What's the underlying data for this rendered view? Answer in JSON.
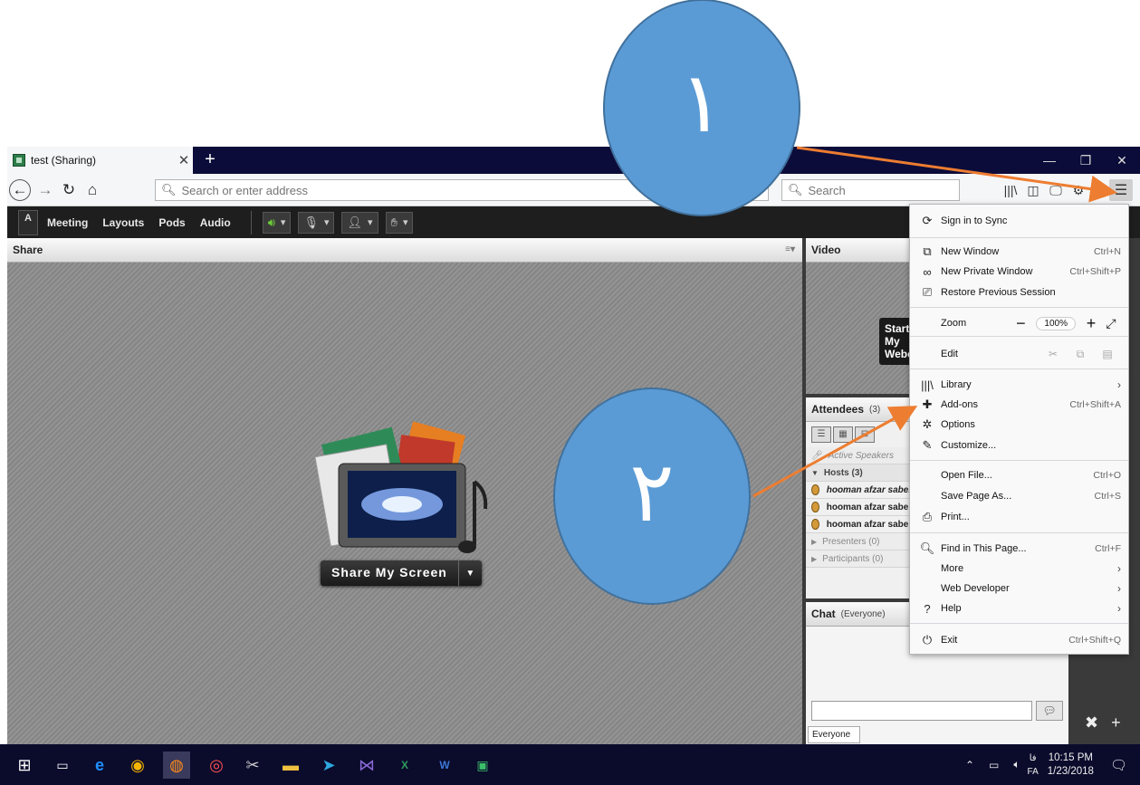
{
  "browser": {
    "tab_title": "test (Sharing)",
    "new_tab": "+",
    "url_placeholder": "Search or enter address",
    "search_placeholder": "Search"
  },
  "app": {
    "logo_text": "Adobe",
    "menu": [
      "Meeting",
      "Layouts",
      "Pods",
      "Audio"
    ],
    "share_pod_title": "Share",
    "share_button_label": "Share My Screen",
    "video_pod_title": "Video",
    "start_camera_label": "Start My Webcam",
    "attendees_title": "Attendees",
    "attendees_count": "(3)",
    "attendee_rows": [
      {
        "kind": "dim",
        "label": "Active Speakers"
      },
      {
        "kind": "sect",
        "label": "Hosts (3)"
      },
      {
        "kind": "user",
        "label": "hooman afzar saberi"
      },
      {
        "kind": "user",
        "label": "hooman afzar saberi"
      },
      {
        "kind": "user",
        "label": "hooman afzar saberi"
      },
      {
        "kind": "dim",
        "label": "Presenters (0)"
      },
      {
        "kind": "dim",
        "label": "Participants (0)"
      }
    ],
    "chat_title": "Chat",
    "chat_scope": "(Everyone)",
    "chat_tab": "Everyone"
  },
  "firefox_menu": {
    "sign_in": "Sign in to Sync",
    "new_window": "New Window",
    "new_window_sc": "Ctrl+N",
    "new_private": "New Private Window",
    "new_private_sc": "Ctrl+Shift+P",
    "restore": "Restore Previous Session",
    "zoom_label": "Zoom",
    "zoom_value": "100%",
    "edit_label": "Edit",
    "library": "Library",
    "addons": "Add-ons",
    "addons_sc": "Ctrl+Shift+A",
    "options": "Options",
    "customize": "Customize...",
    "open_file": "Open File...",
    "open_file_sc": "Ctrl+O",
    "save_page": "Save Page As...",
    "save_page_sc": "Ctrl+S",
    "print": "Print...",
    "find": "Find in This Page...",
    "find_sc": "Ctrl+F",
    "more": "More",
    "web_developer": "Web Developer",
    "help": "Help",
    "exit": "Exit",
    "exit_sc": "Ctrl+Shift+Q"
  },
  "taskbar": {
    "time": "10:15 PM",
    "date": "1/23/2018",
    "lang": "FA",
    "lang_top": "فا"
  },
  "annotations": {
    "step1": "١",
    "step2": "٢",
    "circle_color": "#5b9bd5",
    "arrow_color": "#ed7d31"
  },
  "colors": {
    "tabbar": "#0c0c3a",
    "taskbar": "#0b0b2c",
    "adobe_bar": "#1e1e1e"
  }
}
